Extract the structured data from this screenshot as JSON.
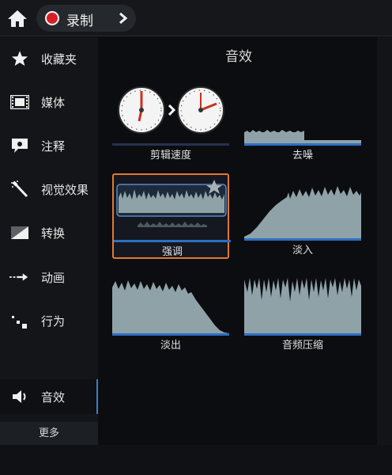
{
  "topbar": {
    "home_icon": "home-icon",
    "record_label": "录制",
    "chevron_icon": "chevron-right-icon"
  },
  "sidebar": {
    "items": [
      {
        "id": "favorites",
        "label": "收藏夹",
        "icon": "star-icon"
      },
      {
        "id": "media",
        "label": "媒体",
        "icon": "film-icon"
      },
      {
        "id": "annotations",
        "label": "注释",
        "icon": "annotation-icon"
      },
      {
        "id": "visual-effects",
        "label": "视觉效果",
        "icon": "magic-wand-icon"
      },
      {
        "id": "transitions",
        "label": "转换",
        "icon": "transition-icon"
      },
      {
        "id": "animations",
        "label": "动画",
        "icon": "animation-icon"
      },
      {
        "id": "behaviors",
        "label": "行为",
        "icon": "behavior-icon"
      },
      {
        "id": "audio-effects",
        "label": "音效",
        "icon": "speaker-icon",
        "active": true
      }
    ],
    "more_label": "更多"
  },
  "panel": {
    "title": "音效",
    "effects": [
      {
        "id": "clip-speed",
        "label": "剪辑速度"
      },
      {
        "id": "noise-removal",
        "label": "去噪"
      },
      {
        "id": "emphasize",
        "label": "强调",
        "selected": true,
        "favorite_icon": "star-icon"
      },
      {
        "id": "fade-in",
        "label": "淡入"
      },
      {
        "id": "fade-out",
        "label": "淡出"
      },
      {
        "id": "audio-compression",
        "label": "音频压缩"
      }
    ]
  },
  "colors": {
    "accent_blue": "#2d6fc4",
    "selection_orange": "#e07a2f",
    "record_red": "#d81f26",
    "waveform": "#8fa2a8"
  }
}
